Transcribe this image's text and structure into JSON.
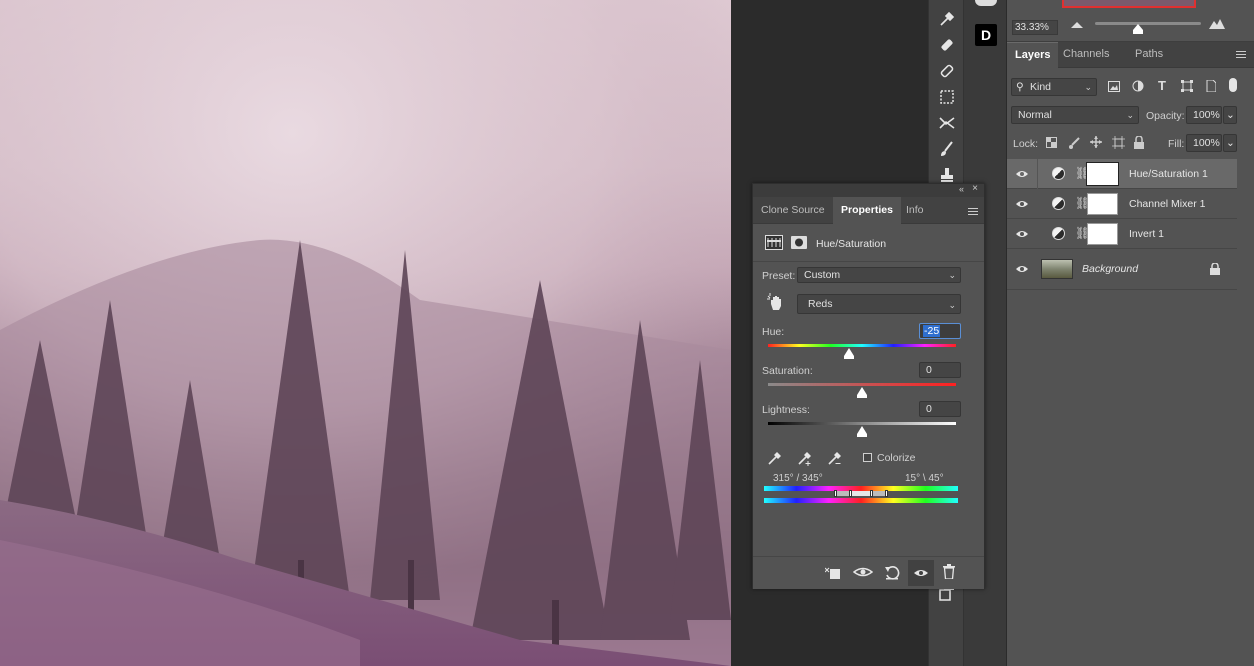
{
  "navigator": {
    "zoom": "33.33%"
  },
  "layers_panel": {
    "tabs": [
      "Layers",
      "Channels",
      "Paths"
    ],
    "filter_kind": "Kind",
    "blend_mode": "Normal",
    "opacity_label": "Opacity:",
    "opacity_value": "100%",
    "lock_label": "Lock:",
    "fill_label": "Fill:",
    "fill_value": "100%",
    "layers": [
      {
        "name": "Hue/Saturation 1",
        "selected": true
      },
      {
        "name": "Channel Mixer 1",
        "selected": false
      },
      {
        "name": "Invert 1",
        "selected": false
      },
      {
        "name": "Background",
        "selected": false
      }
    ]
  },
  "toolbox": {
    "d_icon": "D"
  },
  "properties_panel": {
    "tabs": [
      "Clone Source",
      "Properties",
      "Info"
    ],
    "adjustment_type": "Hue/Saturation",
    "preset_label": "Preset:",
    "preset_value": "Custom",
    "channel_value": "Reds",
    "hue_label": "Hue:",
    "hue_value": "-25",
    "saturation_label": "Saturation:",
    "saturation_value": "0",
    "lightness_label": "Lightness:",
    "lightness_value": "0",
    "colorize_label": "Colorize",
    "colorize_checked": false,
    "range_left": "315° /  345°",
    "range_right": "15° \\  45°",
    "hue_level": -25,
    "saturation_level": 0,
    "lightness_level": 0
  },
  "icons": {
    "eyedropper": "eyedropper-icon",
    "healing": "healing-brush-icon",
    "patch": "patch-icon",
    "marquee": "content-aware-icon",
    "crossfade": "red-eye-icon",
    "brush": "brush-icon",
    "stamp": "clone-stamp-icon",
    "menu": "panel-menu-icon"
  }
}
